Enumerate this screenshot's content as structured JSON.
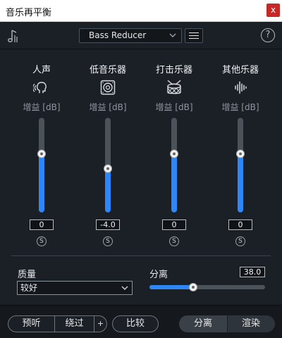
{
  "window": {
    "title": "音乐再平衡",
    "close_glyph": "x"
  },
  "toolbar": {
    "preset_value": "Bass Reducer",
    "help_glyph": "?"
  },
  "stems": [
    {
      "name": "人声",
      "icon": "voice-head-icon",
      "gain_label": "增益 [dB]",
      "value": "0",
      "level": 0.62,
      "solo": "S"
    },
    {
      "name": "低音乐器",
      "icon": "speaker-icon",
      "gain_label": "增益 [dB]",
      "value": "-4.0",
      "level": 0.46,
      "solo": "S"
    },
    {
      "name": "打击乐器",
      "icon": "drum-icon",
      "gain_label": "增益 [dB]",
      "value": "0",
      "level": 0.62,
      "solo": "S"
    },
    {
      "name": "其他乐器",
      "icon": "waveform-icon",
      "gain_label": "增益 [dB]",
      "value": "0",
      "level": 0.62,
      "solo": "S"
    }
  ],
  "quality": {
    "label": "质量",
    "selected": "较好"
  },
  "separation": {
    "label": "分离",
    "value": "38.0",
    "level": 0.38
  },
  "bottom": {
    "preview": "预听",
    "bypass": "绕过",
    "plus": "+",
    "compare": "比较",
    "separate": "分离",
    "render": "渲染"
  },
  "colors": {
    "accent": "#2f86f6",
    "background": "#1b2027",
    "close": "#c62828"
  }
}
